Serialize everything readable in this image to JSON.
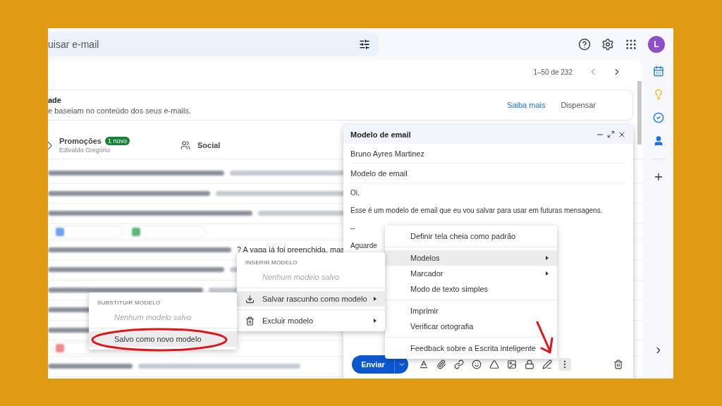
{
  "search": {
    "placeholder": "uisar e-mail"
  },
  "account": {
    "initial": "L"
  },
  "pagination": {
    "range": "1–50 de 232"
  },
  "banner": {
    "title": "ade",
    "text": "e baseiam no conteúdo dos seus e-mails.",
    "actions": [
      "Saiba mais",
      "Dispensar"
    ]
  },
  "category_tabs": [
    {
      "kind": "promotions",
      "label": "Promoções",
      "badge": "1 novo",
      "sender": "Edivaldo Gregório"
    },
    {
      "kind": "social",
      "label": "Social"
    }
  ],
  "email_list": {
    "visible_fragment": "? A vaga já foi preenchida, mas"
  },
  "compose": {
    "title": "Modelo de email",
    "to": "Bruno Ayres Martinez",
    "subject": "Modelo de email",
    "body": [
      "Oi,",
      "Esse é um modelo de email que eu vou salvar para usar em futuras mensagens.",
      "--",
      "Aguarde"
    ],
    "send_label": "Enviar"
  },
  "more_menu": {
    "items": [
      {
        "kind": "item",
        "label": "Definir tela cheia como padrão",
        "selected": false,
        "submenu": false
      },
      {
        "kind": "divider"
      },
      {
        "kind": "item",
        "label": "Modelos",
        "selected": true,
        "submenu": true
      },
      {
        "kind": "item",
        "label": "Marcador",
        "selected": false,
        "submenu": true
      },
      {
        "kind": "item",
        "label": "Modo de texto simples",
        "selected": false,
        "submenu": false
      },
      {
        "kind": "divider"
      },
      {
        "kind": "item",
        "label": "Imprimir",
        "selected": false,
        "submenu": false
      },
      {
        "kind": "item",
        "label": "Verificar ortografia",
        "selected": false,
        "submenu": false
      },
      {
        "kind": "divider"
      },
      {
        "kind": "item",
        "label": "Feedback sobre a Escrita inteligente",
        "selected": false,
        "submenu": false
      }
    ]
  },
  "templates_menu": {
    "items": [
      {
        "kind": "header",
        "label": "INSERIR MODELO"
      },
      {
        "kind": "empty",
        "label": "Nenhum modelo salvo"
      },
      {
        "kind": "divider"
      },
      {
        "kind": "save",
        "label": "Salvar rascunho como modelo",
        "selected": true,
        "submenu": true
      },
      {
        "kind": "divider"
      },
      {
        "kind": "trash",
        "label": "Excluir modelo",
        "selected": false,
        "submenu": true
      }
    ]
  },
  "replace_menu": {
    "items": [
      {
        "kind": "header",
        "label": "SUBSTITUIR MODELO"
      },
      {
        "kind": "empty",
        "label": "Nenhum modelo salvo"
      },
      {
        "kind": "divider"
      },
      {
        "kind": "item",
        "label": "Salvo como novo modelo",
        "selected": true,
        "submenu": false
      }
    ]
  }
}
